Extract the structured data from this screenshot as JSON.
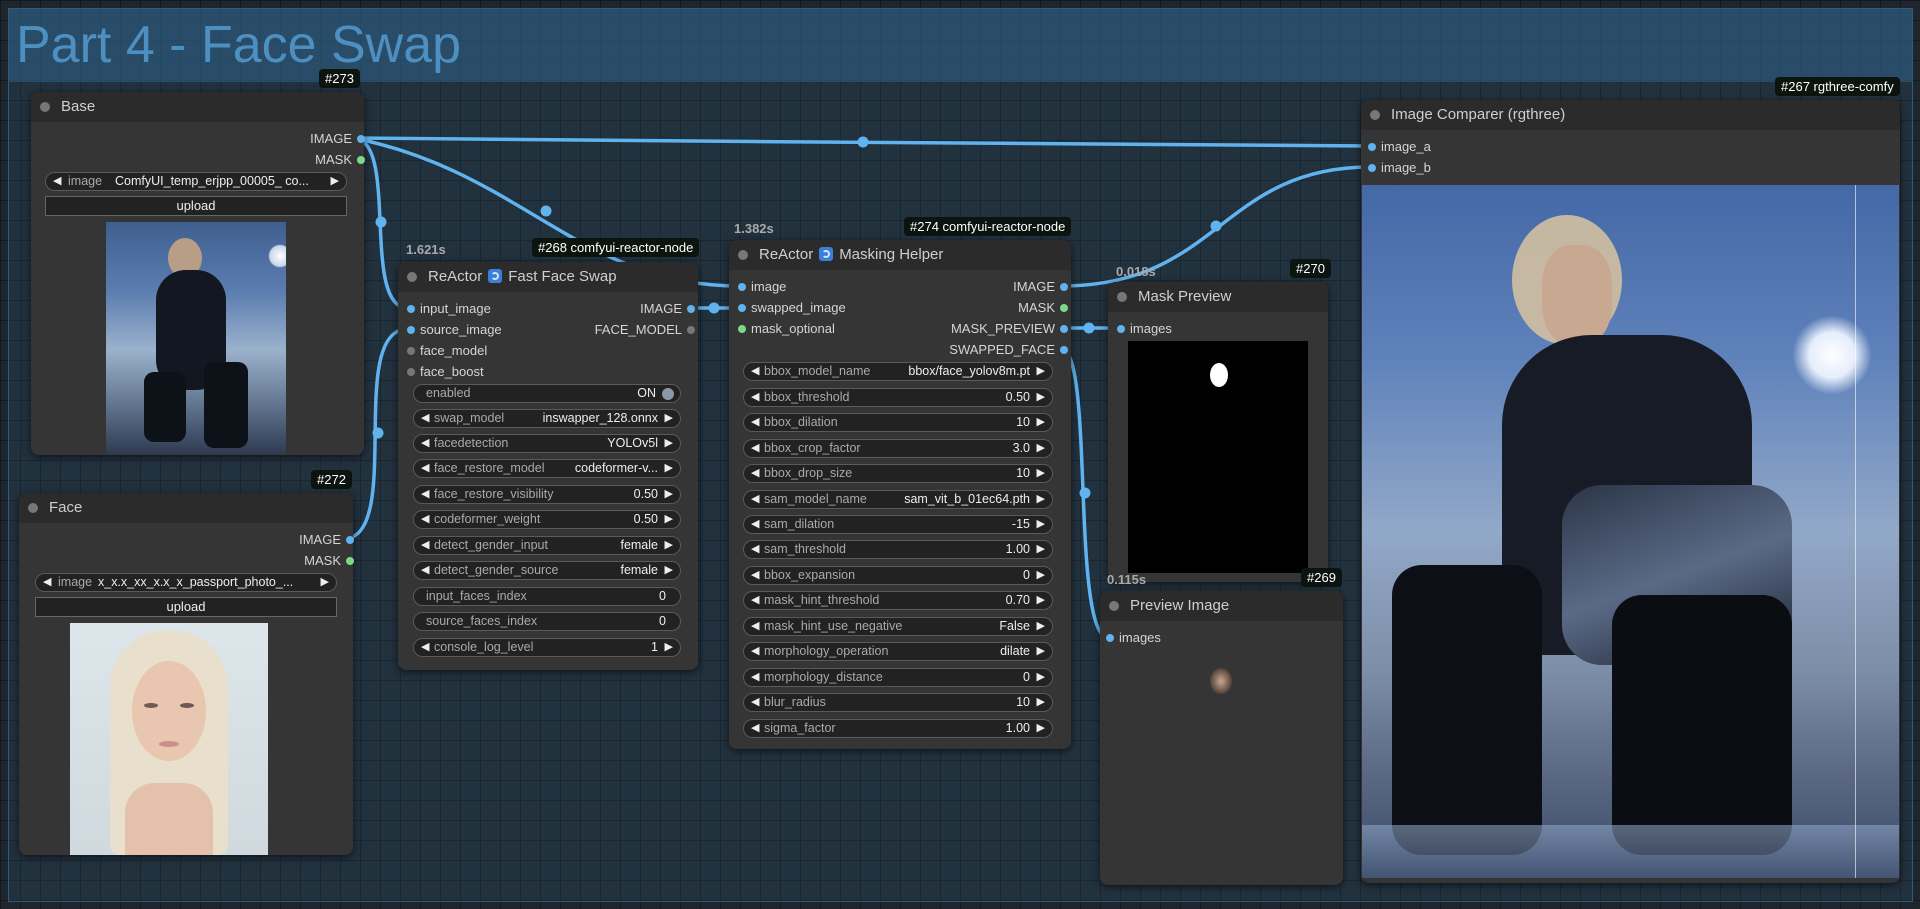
{
  "group": {
    "title": "Part 4 - Face Swap"
  },
  "nodes": {
    "base": {
      "id_badge": "#273",
      "title": "Base",
      "outputs": [
        "IMAGE",
        "MASK"
      ],
      "image_widget": {
        "name": "image",
        "value": "ComfyUI_temp_erjpp_00005_ co..."
      },
      "upload_label": "upload"
    },
    "face": {
      "id_badge": "#272",
      "title": "Face",
      "outputs": [
        "IMAGE",
        "MASK"
      ],
      "image_widget": {
        "name": "image",
        "value": "x_x.x_xx_x.x_x_passport_photo_..."
      },
      "upload_label": "upload"
    },
    "reactor": {
      "id_badge": "#268 comfyui-reactor-node",
      "timing": "1.621s",
      "title_prefix": "ReActor",
      "title_suffix": "Fast Face Swap",
      "inputs": [
        "input_image",
        "source_image",
        "face_model",
        "face_boost"
      ],
      "outputs": [
        "IMAGE",
        "FACE_MODEL"
      ],
      "widgets": [
        {
          "name": "enabled",
          "value": "ON",
          "kind": "toggle"
        },
        {
          "name": "swap_model",
          "value": "inswapper_128.onnx",
          "kind": "combo"
        },
        {
          "name": "facedetection",
          "value": "YOLOv5l",
          "kind": "combo"
        },
        {
          "name": "face_restore_model",
          "value": "codeformer-v...",
          "kind": "combo"
        },
        {
          "name": "face_restore_visibility",
          "value": "0.50",
          "kind": "combo"
        },
        {
          "name": "codeformer_weight",
          "value": "0.50",
          "kind": "combo"
        },
        {
          "name": "detect_gender_input",
          "value": "female",
          "kind": "combo"
        },
        {
          "name": "detect_gender_source",
          "value": "female",
          "kind": "combo"
        },
        {
          "name": "input_faces_index",
          "value": "0",
          "kind": "text"
        },
        {
          "name": "source_faces_index",
          "value": "0",
          "kind": "text"
        },
        {
          "name": "console_log_level",
          "value": "1",
          "kind": "combo"
        }
      ]
    },
    "masking": {
      "id_badge": "#274 comfyui-reactor-node",
      "timing": "1.382s",
      "title_prefix": "ReActor",
      "title_suffix": "Masking Helper",
      "inputs": [
        "image",
        "swapped_image",
        "mask_optional"
      ],
      "outputs": [
        "IMAGE",
        "MASK",
        "MASK_PREVIEW",
        "SWAPPED_FACE"
      ],
      "widgets": [
        {
          "name": "bbox_model_name",
          "value": "bbox/face_yolov8m.pt"
        },
        {
          "name": "bbox_threshold",
          "value": "0.50"
        },
        {
          "name": "bbox_dilation",
          "value": "10"
        },
        {
          "name": "bbox_crop_factor",
          "value": "3.0"
        },
        {
          "name": "bbox_drop_size",
          "value": "10"
        },
        {
          "name": "sam_model_name",
          "value": "sam_vit_b_01ec64.pth"
        },
        {
          "name": "sam_dilation",
          "value": "-15"
        },
        {
          "name": "sam_threshold",
          "value": "1.00"
        },
        {
          "name": "bbox_expansion",
          "value": "0"
        },
        {
          "name": "mask_hint_threshold",
          "value": "0.70"
        },
        {
          "name": "mask_hint_use_negative",
          "value": "False"
        },
        {
          "name": "morphology_operation",
          "value": "dilate"
        },
        {
          "name": "morphology_distance",
          "value": "0"
        },
        {
          "name": "blur_radius",
          "value": "10"
        },
        {
          "name": "sigma_factor",
          "value": "1.00"
        }
      ]
    },
    "mask_preview": {
      "id_badge": "#270",
      "timing": "0.018s",
      "title": "Mask Preview",
      "inputs": [
        "images"
      ]
    },
    "preview_image": {
      "id_badge": "#269",
      "timing": "0.115s",
      "title": "Preview Image",
      "inputs": [
        "images"
      ]
    },
    "comparer": {
      "id_badge": "#267 rgthree-comfy",
      "title": "Image Comparer (rgthree)",
      "inputs": [
        "image_a",
        "image_b"
      ]
    }
  },
  "colors": {
    "link": "#60b3ee",
    "mask_slot": "#7ed889",
    "group_title": "#4d8fc1"
  }
}
